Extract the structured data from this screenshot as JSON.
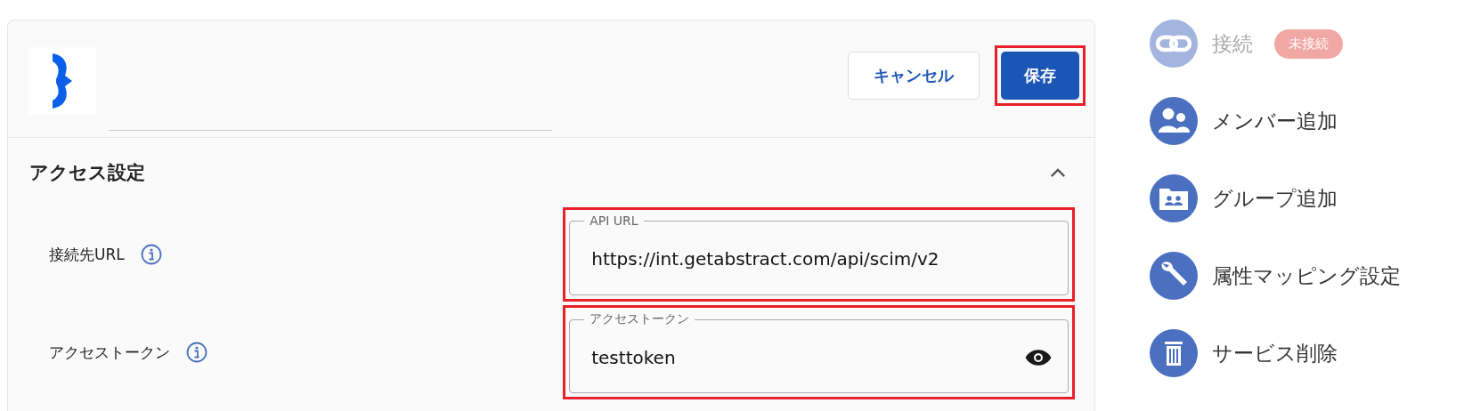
{
  "header": {
    "buttons": [
      {
        "label": "キャンセル",
        "kind": "secondary",
        "highlighted": false
      },
      {
        "label": "保存",
        "kind": "primary",
        "highlighted": true
      }
    ]
  },
  "section": {
    "title": "アクセス設定",
    "expanded": true,
    "fields": [
      {
        "label": "接続先URL",
        "field_label": "API URL",
        "value": "https://int.getabstract.com/api/scim/v2",
        "kind": "text",
        "highlighted": true
      },
      {
        "label": "アクセストークン",
        "field_label": "アクセストークン",
        "value": "testtoken",
        "kind": "secret",
        "highlighted": true
      }
    ]
  },
  "sidebar": {
    "items": [
      {
        "label": "接続",
        "kind": "link",
        "disabled": true,
        "badge": "未接続"
      },
      {
        "label": "メンバー追加",
        "kind": "members",
        "disabled": false
      },
      {
        "label": "グループ追加",
        "kind": "group",
        "disabled": false
      },
      {
        "label": "属性マッピング設定",
        "kind": "wrench",
        "disabled": false
      },
      {
        "label": "サービス削除",
        "kind": "trash",
        "disabled": false
      }
    ]
  }
}
